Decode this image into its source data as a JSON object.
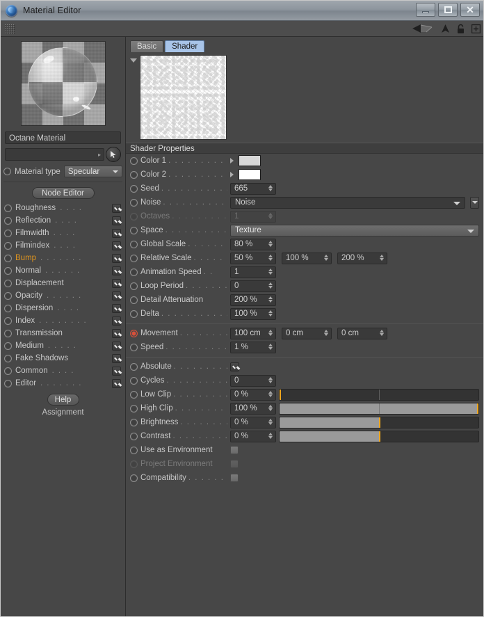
{
  "window": {
    "title": "Material Editor",
    "logo_icon": "cinema4d-logo-icon",
    "minimize_label": "",
    "maximize_label": "",
    "close_label": "✕"
  },
  "toolbar": {
    "grip_icon": "drag-grip-icon",
    "icons": [
      "back-arrow-icon",
      "up-arrow-icon",
      "lock-icon",
      "expand-plus-icon"
    ]
  },
  "sidebar": {
    "preview_icon": "material-preview-sphere",
    "material_name": "Octane Material",
    "search_value": "",
    "search_arrow_icon": "right-arrow-icon",
    "picker_icon": "cursor-pointer-icon",
    "material_type_label": "Material type",
    "material_type_value": "Specular",
    "node_editor_label": "Node Editor",
    "channels": [
      {
        "label": "Roughness",
        "dots": ". . . .",
        "checked": true,
        "highlight": false
      },
      {
        "label": "Reflection",
        "dots": ". . . .",
        "checked": true,
        "highlight": false
      },
      {
        "label": "Filmwidth",
        "dots": ". . . .",
        "checked": true,
        "highlight": false
      },
      {
        "label": "Filmindex",
        "dots": ". . . .",
        "checked": true,
        "highlight": false
      },
      {
        "label": "Bump",
        "dots": ". . . . . . .",
        "checked": true,
        "highlight": true
      },
      {
        "label": "Normal",
        "dots": ". . . . . .",
        "checked": true,
        "highlight": false
      },
      {
        "label": "Displacement",
        "dots": "",
        "checked": true,
        "highlight": false
      },
      {
        "label": "Opacity",
        "dots": ". . . . . .",
        "checked": true,
        "highlight": false
      },
      {
        "label": "Dispersion",
        "dots": ". . . .",
        "checked": true,
        "highlight": false
      },
      {
        "label": "Index",
        "dots": ". . . . . . . .",
        "checked": true,
        "highlight": false
      },
      {
        "label": "Transmission",
        "dots": "",
        "checked": true,
        "highlight": false
      },
      {
        "label": "Medium",
        "dots": ". . . . .",
        "checked": true,
        "highlight": false
      },
      {
        "label": "Fake Shadows",
        "dots": "",
        "checked": true,
        "highlight": false
      },
      {
        "label": "Common",
        "dots": ". . . .",
        "checked": true,
        "highlight": false
      },
      {
        "label": "Editor",
        "dots": ". . . . . . .",
        "checked": true,
        "highlight": false
      }
    ],
    "help_label": "Help",
    "assignment_label": "Assignment"
  },
  "main": {
    "tabs": [
      {
        "label": "Basic",
        "active": false
      },
      {
        "label": "Shader",
        "active": true
      }
    ],
    "collapse_icon": "collapse-triangle-icon",
    "texture_preview_icon": "noise-texture-preview",
    "section_title": "Shader Properties",
    "noise_dropdown_expand_icon": "dropdown-expand-icon",
    "rows": {
      "color1": {
        "label": "Color 1",
        "dots": ". . . . . . . . .",
        "color": "#d8d8d8"
      },
      "color2": {
        "label": "Color 2",
        "dots": ". . . . . . . . .",
        "color": "#ffffff"
      },
      "seed": {
        "label": "Seed",
        "dots": ". . . . . . . . . . . .",
        "value": "665"
      },
      "noise": {
        "label": "Noise",
        "dots": ". . . . . . . . . . .",
        "value": "Noise"
      },
      "octaves": {
        "label": "Octaves",
        "dots": ". . . . . . . . . .",
        "value": "1",
        "disabled": true
      },
      "space": {
        "label": "Space",
        "dots": ". . . . . . . . . . . .",
        "value": "Texture"
      },
      "global_scale": {
        "label": "Global Scale",
        "dots": ". . . . . .",
        "value": "80 %"
      },
      "relative_scale": {
        "label": "Relative Scale",
        "dots": ". . . . .",
        "value": "50 %",
        "value2": "100 %",
        "value3": "200 %"
      },
      "animation_speed": {
        "label": "Animation Speed",
        "dots": ". .",
        "value": "1"
      },
      "loop_period": {
        "label": "Loop Period",
        "dots": ". . . . . . .",
        "value": "0"
      },
      "detail_attenuation": {
        "label": "Detail Attenuation",
        "dots": "",
        "value": "200 %"
      },
      "delta": {
        "label": "Delta",
        "dots": ". . . . . . . . . . . .",
        "value": "100 %"
      },
      "movement": {
        "label": "Movement",
        "dots": ". . . . . . . .",
        "value": "100 cm",
        "value2": "0 cm",
        "value3": "0 cm",
        "keyed": true
      },
      "speed": {
        "label": "Speed",
        "dots": ". . . . . . . . . . . .",
        "value": "1 %"
      },
      "absolute": {
        "label": "Absolute",
        "dots": ". . . . . . . . . .",
        "checked": true
      },
      "cycles": {
        "label": "Cycles",
        "dots": ". . . . . . . . . . . .",
        "value": "0"
      },
      "low_clip": {
        "label": "Low Clip",
        "dots": ". . . . . . . . . .",
        "value": "0 %",
        "fill_pct": 0,
        "handle_pct": 0
      },
      "high_clip": {
        "label": "High Clip",
        "dots": ". . . . . . . . .",
        "value": "100 %",
        "fill_pct": 100,
        "handle_pct": 100
      },
      "brightness": {
        "label": "Brightness",
        "dots": ". . . . . . . .",
        "value": "0 %",
        "fill_pct": 50,
        "handle_pct": 50
      },
      "contrast": {
        "label": "Contrast",
        "dots": ". . . . . . . . . .",
        "value": "0 %",
        "fill_pct": 50,
        "handle_pct": 50
      },
      "use_as_environment": {
        "label": "Use as Environment",
        "dots": "",
        "checked": false
      },
      "project_environment": {
        "label": "Project Environment",
        "dots": "",
        "checked": false,
        "disabled": true
      },
      "compatibility": {
        "label": "Compatibility",
        "dots": ". . . . . .",
        "checked": false
      }
    }
  },
  "colors": {
    "panel_bg": "#474747",
    "accent_orange": "#f0a71d",
    "tab_active": "#a8c4e8",
    "label_highlight": "#e0951f"
  }
}
